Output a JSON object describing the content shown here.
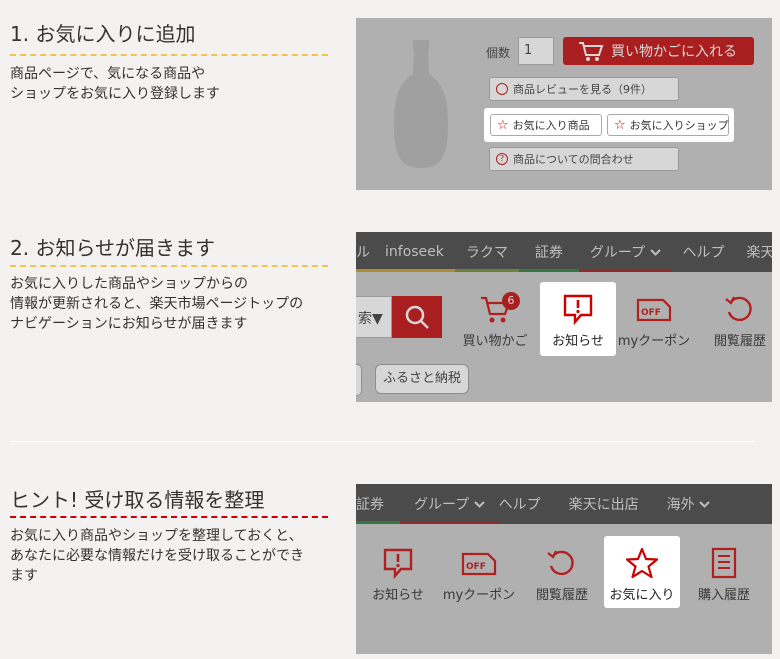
{
  "section1": {
    "title": "1. お気に入りに追加",
    "desc": [
      "商品ページで、気になる商品や",
      "ショップをお気に入り登録します"
    ],
    "qty_label": "個数",
    "qty_value": "1",
    "cart_button": "買い物かごに入れる",
    "review_button": "商品レビューを見る（9件）",
    "fav_item_button": "お気に入り商品",
    "fav_shop_button": "お気に入りショップ",
    "inquiry_button": "商品についての問合わせ"
  },
  "section2": {
    "title": "2. お知らせが届きます",
    "desc": [
      "お気に入りした商品やショップからの",
      "情報が更新されると、楽天市場ページトップの",
      "ナビゲーションにお知らせが届きます"
    ],
    "nav_items": [
      "ル",
      "infoseek",
      "ラクマ",
      "証券",
      "グループ",
      "ヘルプ",
      "楽天"
    ],
    "search_fragment": "索▼",
    "cart_label": "買い物かご",
    "cart_badge": "6",
    "notice_label": "お知らせ",
    "coupon_label": "myクーポン",
    "history_label": "閲覧履歴",
    "furusato": "ふるさと納税",
    "off_text": "OFF"
  },
  "section3": {
    "title": "ヒント! 受け取る情報を整理",
    "desc": [
      "お気に入り商品やショップを整理しておくと、",
      "あなたに必要な情報だけを受け取ることができ",
      "ます"
    ],
    "nav_items": [
      "証券",
      "グループ",
      "ヘルプ",
      "楽天に出店",
      "海外"
    ],
    "notice_label": "お知らせ",
    "coupon_label": "myクーポン",
    "history_label": "閲覧履歴",
    "fav_label": "お気に入り",
    "purchase_label": "購入履歴",
    "off_text": "OFF"
  },
  "colors": {
    "accent_red": "#bf0000",
    "dash_yellow": "#f3c34d",
    "nav_bg": "#3d3d3d",
    "panel_bg": "#cacaca"
  }
}
